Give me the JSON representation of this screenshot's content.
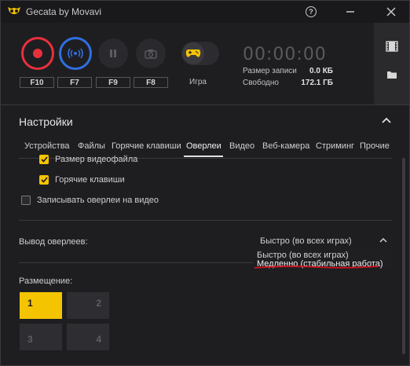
{
  "window": {
    "title": "Gecata by Movavi"
  },
  "controls": {
    "hotkeys": [
      "F10",
      "F7",
      "F9",
      "F8"
    ],
    "game_mode_label": "Игра",
    "timer": "00:00:00",
    "record_size_label": "Размер записи",
    "record_size_value": "0.0 КБ",
    "free_label": "Свободно",
    "free_value": "172.1 ГБ"
  },
  "settings": {
    "title": "Настройки",
    "tabs": [
      "Устройства",
      "Файлы",
      "Горячие клавиши",
      "Оверлеи",
      "Видео",
      "Веб-камера",
      "Стриминг",
      "Прочие"
    ],
    "active_tab": "Оверлеи",
    "overlay_options": [
      {
        "label": "Размер видеофайла",
        "checked": true
      },
      {
        "label": "Горячие клавиши",
        "checked": true
      },
      {
        "label": "Записывать оверлеи на видео",
        "checked": false
      }
    ],
    "overlay_output_label": "Вывод оверлеев:",
    "overlay_output_selected": "Быстро (во всех играх)",
    "overlay_output_options": [
      "Быстро (во всех играх)",
      "Медленно (стабильная работа)"
    ],
    "placement_label": "Размещение:",
    "placement_cells": [
      "1",
      "2",
      "3",
      "4"
    ],
    "placement_selected": "1"
  },
  "colors": {
    "accent_yellow": "#f5c400",
    "record_red": "#e8303c",
    "stream_blue": "#2f6fe0",
    "annotation_red": "#d0101e"
  },
  "icons": [
    "owl-logo-icon",
    "help-icon",
    "minimize-icon",
    "close-icon",
    "record-icon",
    "stream-icon",
    "pause-icon",
    "camera-icon",
    "gamepad-icon",
    "film-icon",
    "folder-icon",
    "chevron-up-icon",
    "chevron-down-icon",
    "checkmark-icon"
  ]
}
